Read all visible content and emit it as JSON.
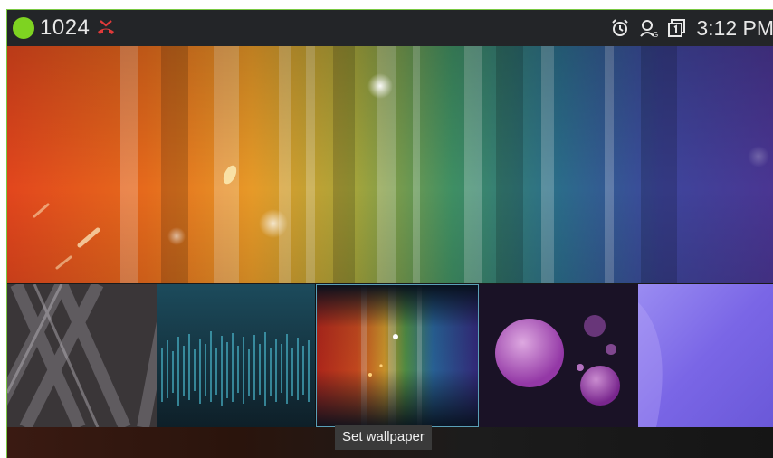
{
  "status_bar": {
    "presence_color": "#7ed321",
    "extension": "1024",
    "missed_call_icon": "missed-call-icon",
    "icons": [
      "alarm-icon",
      "account-icon",
      "sim-icon"
    ],
    "time": "3:12 PM"
  },
  "preview": {
    "wallpaper": "spectrum-streaks"
  },
  "thumbnails": [
    {
      "name": "diagonal-lines"
    },
    {
      "name": "blue-waveform"
    },
    {
      "name": "spectrum-streaks",
      "selected": true
    },
    {
      "name": "purple-bokeh"
    },
    {
      "name": "violet-gradient"
    }
  ],
  "actions": {
    "set_wallpaper": "Set wallpaper"
  }
}
